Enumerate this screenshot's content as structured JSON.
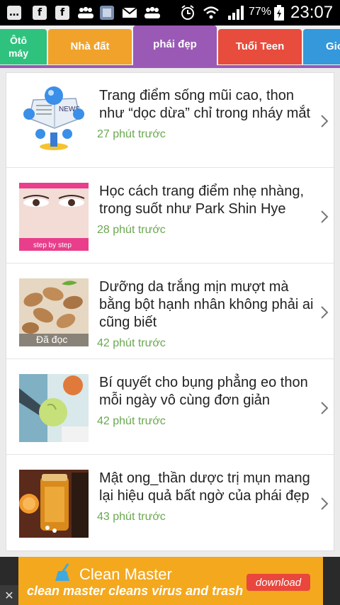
{
  "status_bar": {
    "icons": [
      "messages-icon",
      "facebook-icon",
      "facebook-icon",
      "group-icon",
      "app-icon",
      "mail-icon",
      "group-icon"
    ],
    "right_icons": [
      "alarm-icon",
      "wifi-icon",
      "signal-icon",
      "battery-charging-icon"
    ],
    "battery": "77%",
    "time": "23:07"
  },
  "tabs": [
    {
      "label": "Ôtô\nmáy",
      "color": "#2ec27e"
    },
    {
      "label": "Nhà đất",
      "color": "#f0a22b"
    },
    {
      "label": "phái đẹp",
      "color": "#9b59b6",
      "active": true
    },
    {
      "label": "Tuổi Teen",
      "color": "#e74c3c"
    },
    {
      "label": "Gio",
      "color": "#3498db"
    }
  ],
  "articles": [
    {
      "title": "Trang điểm sống mũi cao, thon như “dọc dừa” chỉ trong nháy mắt",
      "time": "27 phút trước",
      "thumb": "news-thumbnail",
      "badge": "NEWS"
    },
    {
      "title": "Học cách trang điểm nhẹ nhàng, trong suốt như Park Shin Hye",
      "time": "28 phút trước",
      "thumb": "eye-makeup-thumbnail",
      "badge": "step by step"
    },
    {
      "title": "Dưỡng da trắng mịn mượt mà bằng bột hạnh nhân không phải ai cũng biết",
      "time": "42 phút trước",
      "thumb": "almond-thumbnail",
      "badge": "Đã đọc"
    },
    {
      "title": "Bí quyết cho bụng phẳng eo thon mỗi ngày vô cùng đơn giản",
      "time": "42 phút trước",
      "thumb": "apple-thumbnail",
      "badge": ""
    },
    {
      "title": "Mật ong_thần dược trị mụn mang lại hiệu quả bất ngờ của phái đẹp",
      "time": "43 phút trước",
      "thumb": "honey-thumbnail",
      "badge": ""
    }
  ],
  "ad": {
    "title": "Clean Master",
    "subtitle": "clean master cleans virus and trash",
    "button": "download",
    "close": "✕"
  }
}
